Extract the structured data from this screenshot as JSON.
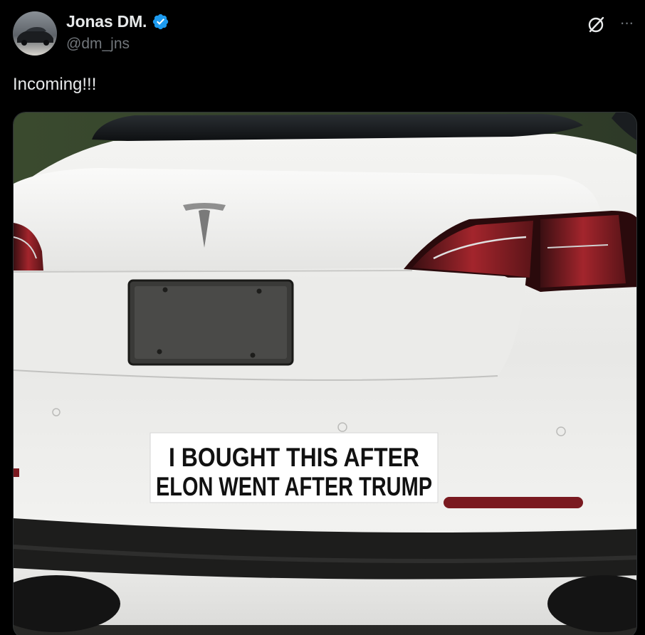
{
  "post": {
    "author": {
      "display_name": "Jonas DM.",
      "handle": "@dm_jns",
      "verified": true,
      "verified_color": "#1d9bf0"
    },
    "text": "Incoming!!!",
    "media": {
      "sticker_line1": "I BOUGHT THIS AFTER",
      "sticker_line2": "ELON WENT AFTER TRUMP"
    },
    "header_icons": [
      "grok-icon",
      "more-icon"
    ]
  }
}
